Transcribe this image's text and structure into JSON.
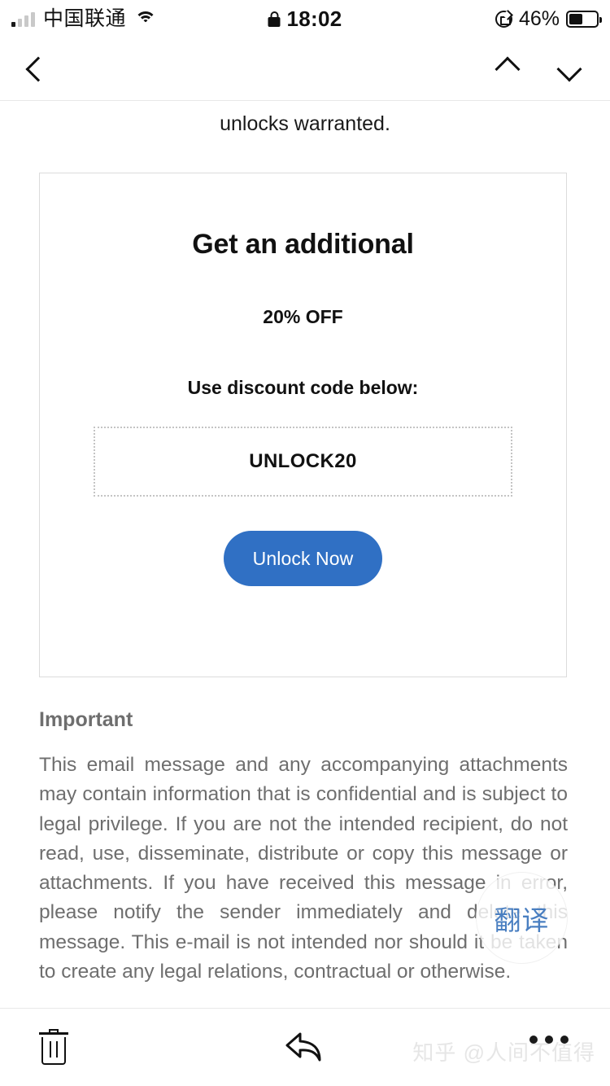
{
  "status_bar": {
    "carrier": "中国联通",
    "time": "18:02",
    "battery_percent": "46%",
    "battery_level": 46,
    "signal_icon": "signal-bars-icon",
    "wifi_icon": "wifi-icon",
    "lock_icon": "lock-icon",
    "rotation_lock_icon": "rotation-lock-icon",
    "battery_icon": "battery-icon"
  },
  "nav_bar": {
    "back_icon": "chevron-left-icon",
    "prev_message_icon": "chevron-up-icon",
    "next_message_icon": "chevron-down-icon"
  },
  "email": {
    "lead_text": "unlocks warranted.",
    "promo": {
      "headline": "Get an additional",
      "discount": "20% OFF",
      "instruction": "Use discount code below:",
      "code": "UNLOCK20",
      "cta_label": "Unlock Now",
      "cta_color": "#3070c4",
      "border_color": "#dcdcdc",
      "code_border_color": "#c4c4c4"
    },
    "important_heading": "Important",
    "disclaimer": "This email message and any accompanying attachments may contain information that is confidential and is subject to legal privilege. If you are not the intended recipient, do not read, use, disseminate, distribute or copy this message or attachments. If you have received this message in error, please notify the sender immediately and delete this message. This e-mail is not intended nor should it be taken to create any legal relations, contractual or otherwise.",
    "disclaimer_color": "#6e6e6e"
  },
  "translate_button": {
    "label": "翻译",
    "color": "#4a7fc1"
  },
  "toolbar": {
    "delete_icon": "trash-icon",
    "reply_icon": "reply-arrow-icon",
    "more_icon": "more-dots-icon",
    "watermark": "知乎 @人间不值得"
  }
}
